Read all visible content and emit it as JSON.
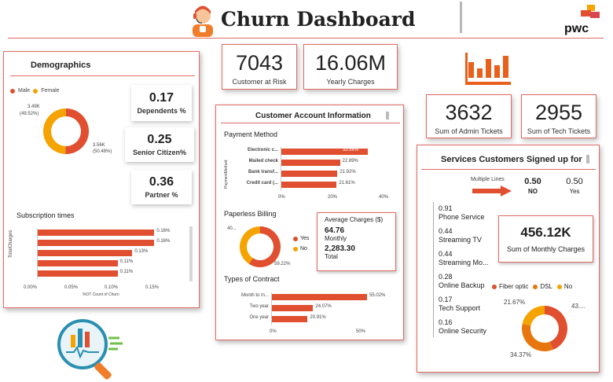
{
  "header": {
    "title": "Churn Dashboard",
    "brand": "pwc",
    "colors": {
      "title": "#d9484f",
      "accent": "#e04f2f",
      "orange": "#f5a300",
      "rule": "#e06b63"
    }
  },
  "kpis": {
    "customers_at_risk": {
      "value": "7043",
      "label": "Customer at Risk"
    },
    "yearly_charges": {
      "value": "16.06M",
      "label": "Yearly Charges"
    },
    "admin_tickets": {
      "value": "3632",
      "label": "Sum of Admin Tickets"
    },
    "tech_tickets": {
      "value": "2955",
      "label": "Sum of Tech Tickets"
    }
  },
  "demographics": {
    "title": "Demographics",
    "legend": [
      {
        "label": "Male",
        "color": "#e04f2f"
      },
      {
        "label": "Female",
        "color": "#f5a300"
      }
    ],
    "donut": {
      "female_label": "3.49K",
      "female_pct": "(49.52%)",
      "male_label": "3.56K",
      "male_pct": "(50.48%)"
    },
    "dependents": {
      "value": "0.17",
      "label": "Dependents %"
    },
    "senior": {
      "value": "0.25",
      "label": "Senior Citizen%"
    },
    "partner": {
      "value": "0.36",
      "label": "Partner %"
    },
    "subscription": {
      "title": "Subscription times",
      "ylabel": "TotalCharges",
      "xlabel": "%OT Count of Churn",
      "ticks": [
        "0.00%",
        "0.05%",
        "0.10%",
        "0.15%"
      ]
    }
  },
  "account": {
    "title": "Customer Account Information",
    "payment": {
      "title": "Payment Method",
      "ylabel": "PaymentMethod",
      "ticks": [
        "0%",
        "20%",
        "40%"
      ]
    },
    "paperless": {
      "title": "Paperless Billing",
      "legend": [
        {
          "label": "Yes",
          "color": "#e04f2f"
        },
        {
          "label": "No",
          "color": "#f5a300"
        }
      ],
      "label_left": "40...",
      "label_right": "59.22%"
    },
    "avg_charges": {
      "title": "Average Charges ($)",
      "monthly_value": "64.76",
      "monthly_label": "Monthly",
      "total_value": "2,283.30",
      "total_label": "Total"
    },
    "contract": {
      "title": "Types of Contract",
      "ticks": [
        "0%",
        "50%"
      ]
    }
  },
  "services": {
    "title": "Services Customers Signed up for",
    "multiple_lines": {
      "label": "Multiple Lines",
      "no_value": "0.50",
      "no_label": "NO",
      "yes_value": "0.50",
      "yes_label": "Yes"
    },
    "items": [
      {
        "value": "0.91",
        "label": "Phone Service"
      },
      {
        "value": "0.44",
        "label": "Streaming TV"
      },
      {
        "value": "0.44",
        "label": "Streaming Mo..."
      },
      {
        "value": "0.28",
        "label": "Online Backup"
      },
      {
        "value": "0.17",
        "label": "Tech Support"
      },
      {
        "value": "0.16",
        "label": "Online Security"
      }
    ],
    "monthly": {
      "value": "456.12K",
      "label": "Sum of Monthly Charges"
    },
    "internet": {
      "legend": [
        {
          "label": "Fiber optic",
          "color": "#e04f2f"
        },
        {
          "label": "DSL",
          "color": "#e8760f"
        },
        {
          "label": "No",
          "color": "#f5a300"
        }
      ],
      "label_left": "21.67%",
      "label_right": "43....",
      "label_bottom": "34.37%"
    }
  },
  "chart_data": [
    {
      "type": "pie",
      "title": "Demographics",
      "categories": [
        "Male",
        "Female"
      ],
      "values": [
        3560,
        3490
      ],
      "labels": [
        "3.56K (50.48%)",
        "3.49K (49.52%)"
      ]
    },
    {
      "type": "bar",
      "title": "Subscription times",
      "xlabel": "%OT Count of Churn",
      "ylabel": "TotalCharges",
      "categories": [
        "",
        "",
        "",
        "",
        ""
      ],
      "values": [
        0.16,
        0.16,
        0.13,
        0.11,
        0.11
      ],
      "value_labels": [
        "0.16%",
        "0.16%",
        "0.13%",
        "0.11%",
        "0.11%"
      ],
      "xlim": [
        0,
        0.18
      ]
    },
    {
      "type": "bar",
      "title": "Payment Method",
      "ylabel": "PaymentMethod",
      "categories": [
        "Electronic c...",
        "Mailed check",
        "Bank transf...",
        "Credit card (..."
      ],
      "values": [
        33.58,
        22.89,
        21.92,
        21.61
      ],
      "value_labels": [
        "33.58%",
        "22.89%",
        "21.92%",
        "21.61%"
      ],
      "xlim": [
        0,
        40
      ]
    },
    {
      "type": "pie",
      "title": "Paperless Billing",
      "categories": [
        "Yes",
        "No"
      ],
      "values": [
        59.22,
        40.78
      ]
    },
    {
      "type": "bar",
      "title": "Types of Contract",
      "categories": [
        "Month to m...",
        "Two year",
        "One year"
      ],
      "values": [
        55.02,
        24.07,
        20.91
      ],
      "value_labels": [
        "55.02%",
        "24.07%",
        "20.91%"
      ],
      "xlim": [
        0,
        55
      ]
    },
    {
      "type": "pie",
      "categories": [
        "Fiber optic",
        "DSL",
        "No"
      ],
      "values": [
        43.96,
        34.37,
        21.67
      ]
    }
  ]
}
